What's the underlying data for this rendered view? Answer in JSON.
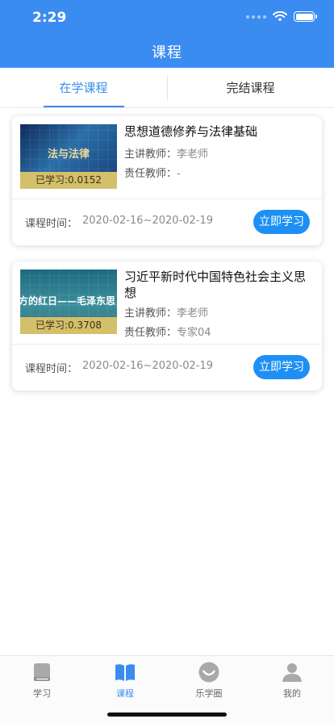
{
  "status": {
    "time": "2:29"
  },
  "header": {
    "title": "课程"
  },
  "tabs": [
    {
      "label": "在学课程",
      "active": true
    },
    {
      "label": "完结课程",
      "active": false
    }
  ],
  "courses": [
    {
      "thumbnail_text": "法与法律",
      "progress": "已学习:0.0152",
      "title": "思想道德修养与法律基础",
      "lecturer_label": "主讲教师：",
      "lecturer": "李老师",
      "responsible_label": "责任教师：",
      "responsible": "-",
      "time_label": "课程时间：",
      "time": "2020-02-16~2020-02-19",
      "button": "立即学习"
    },
    {
      "thumbnail_text": "方的红日——毛泽东思",
      "progress": "已学习:0.3708",
      "title": "习近平新时代中国特色社会主义思想",
      "lecturer_label": "主讲教师：",
      "lecturer": "李老师",
      "responsible_label": "责任教师：",
      "responsible": "专家04",
      "time_label": "课程时间：",
      "time": "2020-02-16~2020-02-19",
      "button": "立即学习"
    }
  ],
  "tabbar": [
    {
      "label": "学习",
      "icon": "book-closed-icon",
      "active": false
    },
    {
      "label": "课程",
      "icon": "book-open-icon",
      "active": true
    },
    {
      "label": "乐学圈",
      "icon": "smile-circle-icon",
      "active": false
    },
    {
      "label": "我的",
      "icon": "person-icon",
      "active": false
    }
  ],
  "colors": {
    "primary": "#3b8cf0",
    "button": "#1e90f5",
    "progress_band": "#d4bf6a"
  }
}
